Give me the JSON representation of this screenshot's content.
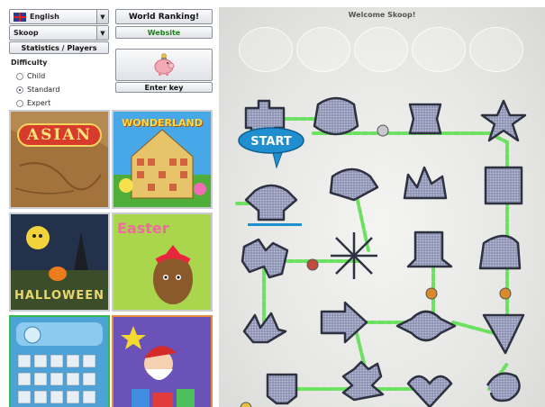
{
  "language_select": {
    "value": "English"
  },
  "profile_select": {
    "value": "Skoop"
  },
  "buttons": {
    "world_ranking": "World Ranking!",
    "website": "Website",
    "statistics": "Statistics / Players",
    "enter_key": "Enter key"
  },
  "difficulty": {
    "title": "Difficulty",
    "options": [
      "Child",
      "Standard",
      "Expert"
    ],
    "selected": "Standard"
  },
  "tiles": [
    {
      "name": "asian",
      "label": "ASIAN"
    },
    {
      "name": "wonderland",
      "label": "WONDERLAND"
    },
    {
      "name": "halloween",
      "label": "HALLOWEEN"
    },
    {
      "name": "easter",
      "label": "Easter"
    },
    {
      "name": "maze",
      "label": ""
    },
    {
      "name": "christmas",
      "label": ""
    }
  ],
  "board": {
    "welcome": "Welcome Skoop!",
    "start_label": "START"
  },
  "colors": {
    "path": "#66e05a",
    "tile_fill": "#a7abc6",
    "tile_edge": "#2e3240",
    "node": "#c6c8ce",
    "accent": "#1f8fcf"
  }
}
